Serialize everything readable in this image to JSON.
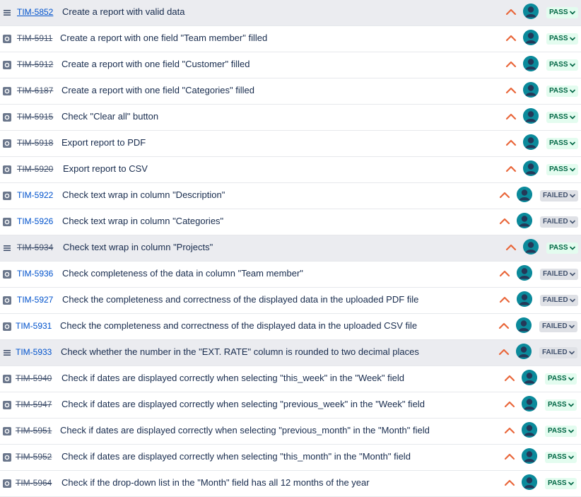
{
  "colors": {
    "pass_bg": "#e3fcef",
    "pass_text": "#006644",
    "failed_bg": "#dfe1e6",
    "failed_text": "#42526e",
    "priority": "#e9673b",
    "avatar": "#0b8a9b",
    "link": "#0052cc"
  },
  "rows": [
    {
      "key": "TIM-5852",
      "summary": "Create a report with valid data",
      "status": "PASS",
      "done": false,
      "type": "story",
      "highlight": true
    },
    {
      "key": "TIM-5911",
      "summary": "Create a report with one field \"Team member\" filled",
      "status": "PASS",
      "done": true,
      "type": "test"
    },
    {
      "key": "TIM-5912",
      "summary": "Create a report with one field \"Customer\" filled",
      "status": "PASS",
      "done": true,
      "type": "test"
    },
    {
      "key": "TIM-6187",
      "summary": "Create a report with one field \"Categories\" filled",
      "status": "PASS",
      "done": true,
      "type": "test"
    },
    {
      "key": "TIM-5915",
      "summary": "Check \"Clear all\" button",
      "status": "PASS",
      "done": true,
      "type": "test"
    },
    {
      "key": "TIM-5918",
      "summary": "Export report to PDF",
      "status": "PASS",
      "done": true,
      "type": "test"
    },
    {
      "key": "TIM-5920",
      "summary": "Export report to CSV",
      "status": "PASS",
      "done": true,
      "type": "test"
    },
    {
      "key": "TIM-5922",
      "summary": "Check text wrap in column \"Description\"",
      "status": "FAILED",
      "done": false,
      "type": "test"
    },
    {
      "key": "TIM-5926",
      "summary": "Check text wrap in column \"Categories\"",
      "status": "FAILED",
      "done": false,
      "type": "test"
    },
    {
      "key": "TIM-5934",
      "summary": "Check text wrap in column \"Projects\"",
      "status": "PASS",
      "done": true,
      "type": "story",
      "highlight": true
    },
    {
      "key": "TIM-5936",
      "summary": "Check completeness of the data in column \"Team member\"",
      "status": "FAILED",
      "done": false,
      "type": "test"
    },
    {
      "key": "TIM-5927",
      "summary": "Check the completeness and correctness of the displayed data in the uploaded PDF file",
      "status": "FAILED",
      "done": false,
      "type": "test"
    },
    {
      "key": "TIM-5931",
      "summary": "Check the completeness and correctness of the displayed data in the uploaded CSV file",
      "status": "FAILED",
      "done": false,
      "type": "test"
    },
    {
      "key": "TIM-5933",
      "summary": "Check whether the number in the \"EXT. RATE\" column is rounded to two decimal places",
      "status": "FAILED",
      "done": false,
      "type": "story",
      "highlight": true
    },
    {
      "key": "TIM-5940",
      "summary": "Check if dates are displayed correctly when selecting \"this_week\" in the \"Week\" field",
      "status": "PASS",
      "done": true,
      "type": "test"
    },
    {
      "key": "TIM-5947",
      "summary": "Check if dates are displayed correctly when selecting \"previous_week\" in the \"Week\" field",
      "status": "PASS",
      "done": true,
      "type": "test"
    },
    {
      "key": "TIM-5951",
      "summary": "Check if dates are displayed correctly when selecting \"previous_month\" in the \"Month\" field",
      "status": "PASS",
      "done": true,
      "type": "test"
    },
    {
      "key": "TIM-5952",
      "summary": "Check if dates are displayed correctly when selecting \"this_month\" in the \"Month\" field",
      "status": "PASS",
      "done": true,
      "type": "test"
    },
    {
      "key": "TIM-5964",
      "summary": "Check if the drop-down list in the \"Month\" field has all 12 months of the year",
      "status": "PASS",
      "done": true,
      "type": "test"
    }
  ]
}
